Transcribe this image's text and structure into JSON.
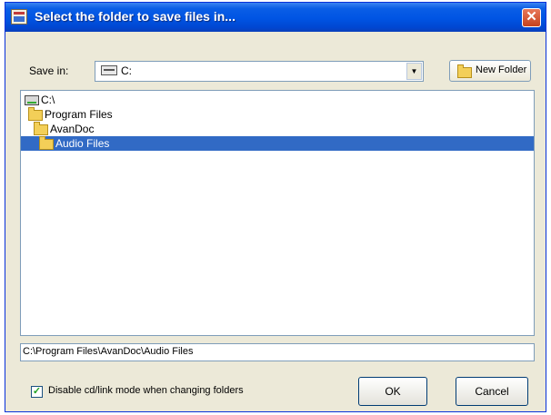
{
  "dialog": {
    "title": "Select the folder to save files in...",
    "close_glyph": "✕"
  },
  "save_in": {
    "label": "Save in:",
    "selected": "C:",
    "arrow_glyph": "▼"
  },
  "toolbar": {
    "new_folder_label": "New Folder"
  },
  "folders": [
    {
      "label": "C:\\",
      "icon": "drive-icon",
      "selected": false
    },
    {
      "label": "Program Files",
      "icon": "folder-icon",
      "selected": false
    },
    {
      "label": "AvanDoc",
      "icon": "folder-icon",
      "selected": false
    },
    {
      "label": "Audio Files",
      "icon": "folder-icon",
      "selected": true
    }
  ],
  "path_field": {
    "value": "C:\\Program Files\\AvanDoc\\Audio Files"
  },
  "options": {
    "disable_cd_label": "Disable cd/link mode when changing folders",
    "checked_glyph": "✓"
  },
  "buttons": {
    "ok_label": "OK",
    "cancel_label": "Cancel"
  },
  "colors": {
    "title_bar": "#0054e3",
    "selection": "#316ac5",
    "dialog_bg": "#ece9d8"
  }
}
